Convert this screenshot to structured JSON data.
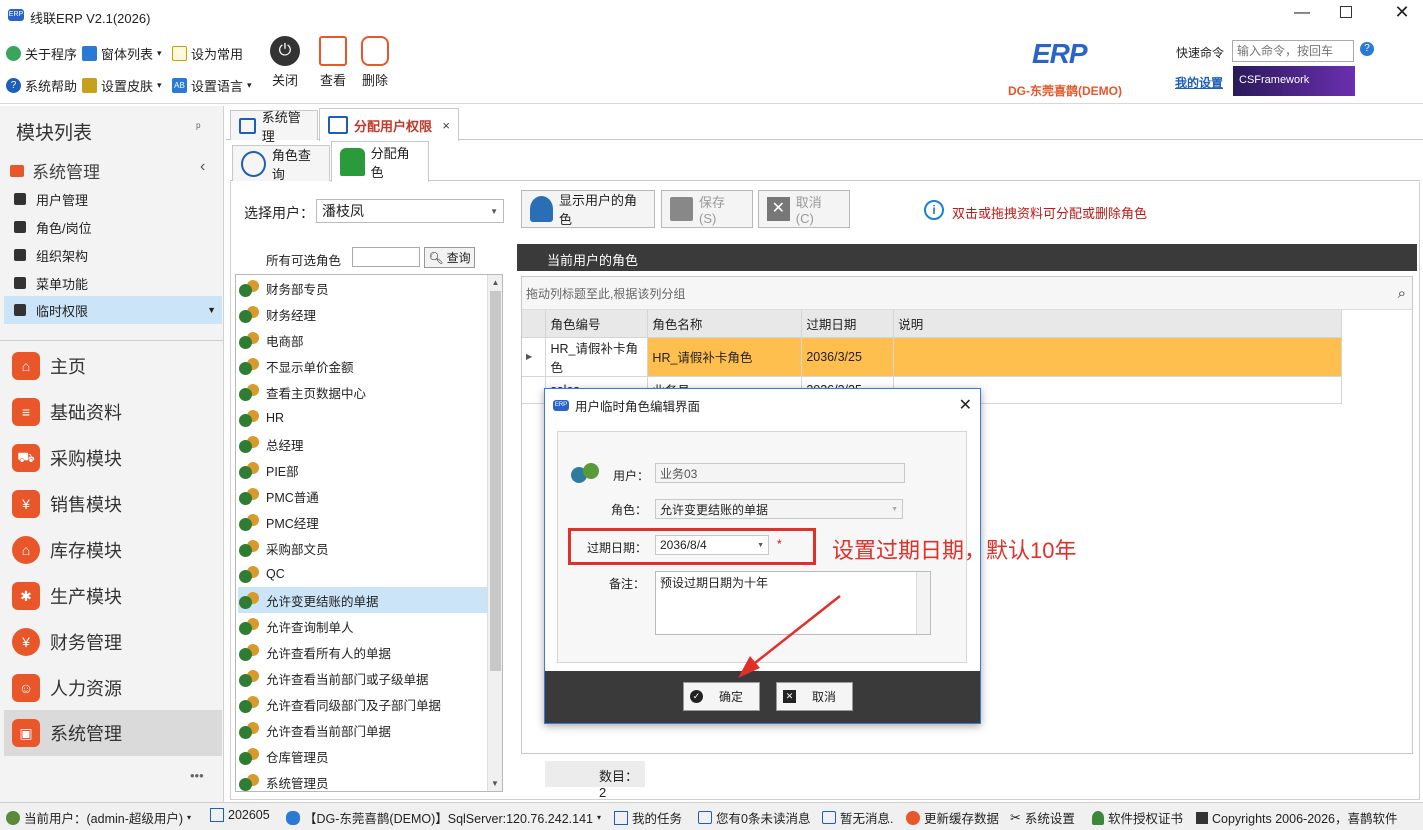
{
  "app": {
    "title": "线联ERP V2.1(2026)",
    "logo_text": "ERP"
  },
  "ribbon": {
    "about": "关于程序",
    "window_list": "窗体列表",
    "set_common": "设为常用",
    "help": "系统帮助",
    "skin": "设置皮肤",
    "language": "设置语言",
    "close": "关闭",
    "view": "查看",
    "delete": "删除",
    "company": "DG-东莞喜鹊(DEMO)",
    "quick_cmd_label": "快速命令",
    "quick_cmd_placeholder": "输入命令，按回车",
    "my_settings": "我的设置",
    "framework_banner": "CSFramework"
  },
  "left": {
    "title": "模块列表",
    "pin": "ᵖ",
    "section": "系统管理",
    "items": [
      "用户管理",
      "角色/岗位",
      "组织架构",
      "菜单功能",
      "临时权限"
    ],
    "modules": [
      "主页",
      "基础资料",
      "采购模块",
      "销售模块",
      "库存模块",
      "生产模块",
      "财务管理",
      "人力资源",
      "系统管理"
    ],
    "more": "•••"
  },
  "tabs": {
    "tab1": "系统管理",
    "tab2": "分配用户权限",
    "close": "×"
  },
  "subtabs": {
    "t1": "角色查询",
    "t2": "分配角色"
  },
  "toolbar": {
    "select_user_label": "选择用户：",
    "select_user_value": "潘枝凤",
    "show_roles": "显示用户的角色",
    "save": "保存 (S)",
    "cancel": "取消 (C)",
    "hint": "双击或拖拽资料可分配或删除角色"
  },
  "available": {
    "label": "所有可选角色",
    "query": "查询",
    "roles": [
      "财务部专员",
      "财务经理",
      "电商部",
      "不显示单价金额",
      "查看主页数据中心",
      "HR",
      "总经理",
      "PIE部",
      "PMC普通",
      "PMC经理",
      "采购部文员",
      "QC",
      "允许变更结账的单据",
      "允许查询制单人",
      "允许查看所有人的单据",
      "允许查看当前部门或子级单据",
      "允许查看同级部门及子部门单据",
      "允许查看当前部门单据",
      "仓库管理员",
      "系统管理员"
    ]
  },
  "current": {
    "header": "当前用户的角色",
    "group_hint": "拖动列标题至此,根据该列分组",
    "columns": [
      "角色编号",
      "角色名称",
      "过期日期",
      "说明"
    ],
    "rows": [
      {
        "code": "HR_请假补卡角色",
        "name": "HR_请假补卡角色",
        "date": "2036/3/25",
        "note": ""
      },
      {
        "code": "sales",
        "name": "业务员",
        "date": "2036/3/25",
        "note": ""
      }
    ],
    "count_label": "数目：",
    "count": "2"
  },
  "dialog": {
    "title": "用户临时角色编辑界面",
    "user_label": "用户：",
    "user_value": "业务03",
    "role_label": "角色：",
    "role_value": "允许变更结账的单据",
    "expire_label": "过期日期：",
    "expire_value": "2036/8/4",
    "required": "*",
    "note_label": "备注：",
    "note_value": "预设过期日期为十年",
    "ok": "确定",
    "cancel": "取消"
  },
  "annotation": "设置过期日期，默认10年",
  "status": {
    "user": "当前用户：(admin-超级用户)",
    "period": "202605",
    "db": "【DG-东莞喜鹊(DEMO)】SqlServer:120.76.242.141",
    "tasks": "我的任务",
    "unread": "您有0条未读消息",
    "nomsg": "暂无消息.",
    "refresh": "更新缓存数据",
    "settings": "系统设置",
    "license": "软件授权证书",
    "copyright": "Copyrights 2006-2026，喜鹊软件"
  },
  "colors": {
    "accent": "#e8562a",
    "selected_row": "#ffbf4f",
    "dark_bar": "#3a3a3a",
    "annotation": "#e0302a"
  }
}
